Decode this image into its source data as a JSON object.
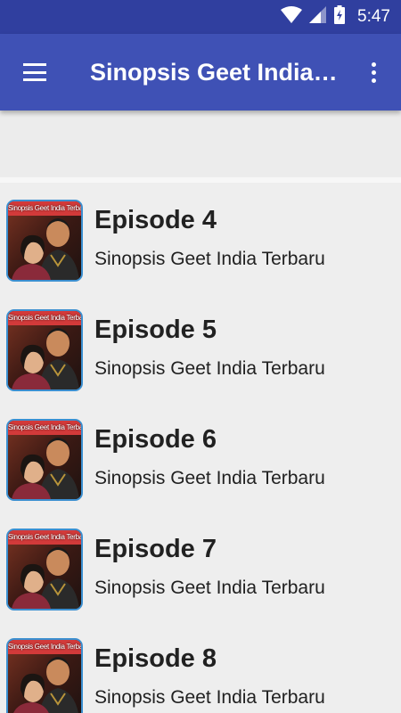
{
  "status_bar": {
    "time": "5:47",
    "icons": [
      "wifi-icon",
      "signal-icon",
      "battery-charging-icon"
    ]
  },
  "app_bar": {
    "title": "Sinopsis Geet India Terbaru",
    "menu_icon": "hamburger-menu-icon",
    "overflow_icon": "more-vert-icon"
  },
  "episodes": [
    {
      "title": "Episode 4",
      "subtitle": "Sinopsis Geet India Terbaru",
      "thumb_text": "Sinopsis Geet India Terbaru"
    },
    {
      "title": "Episode 5",
      "subtitle": "Sinopsis Geet India Terbaru",
      "thumb_text": "Sinopsis Geet India Terbaru"
    },
    {
      "title": "Episode 6",
      "subtitle": "Sinopsis Geet India Terbaru",
      "thumb_text": "Sinopsis Geet India Terbaru"
    },
    {
      "title": "Episode 7",
      "subtitle": "Sinopsis Geet India Terbaru",
      "thumb_text": "Sinopsis Geet India Terbaru"
    },
    {
      "title": "Episode 8",
      "subtitle": "Sinopsis Geet India Terbaru",
      "thumb_text": "Sinopsis Geet India Terbaru"
    }
  ],
  "colors": {
    "status_bar": "#303f9f",
    "app_bar": "#3f51b5",
    "background": "#eeeeee",
    "thumb_border": "#3b8fd0"
  }
}
